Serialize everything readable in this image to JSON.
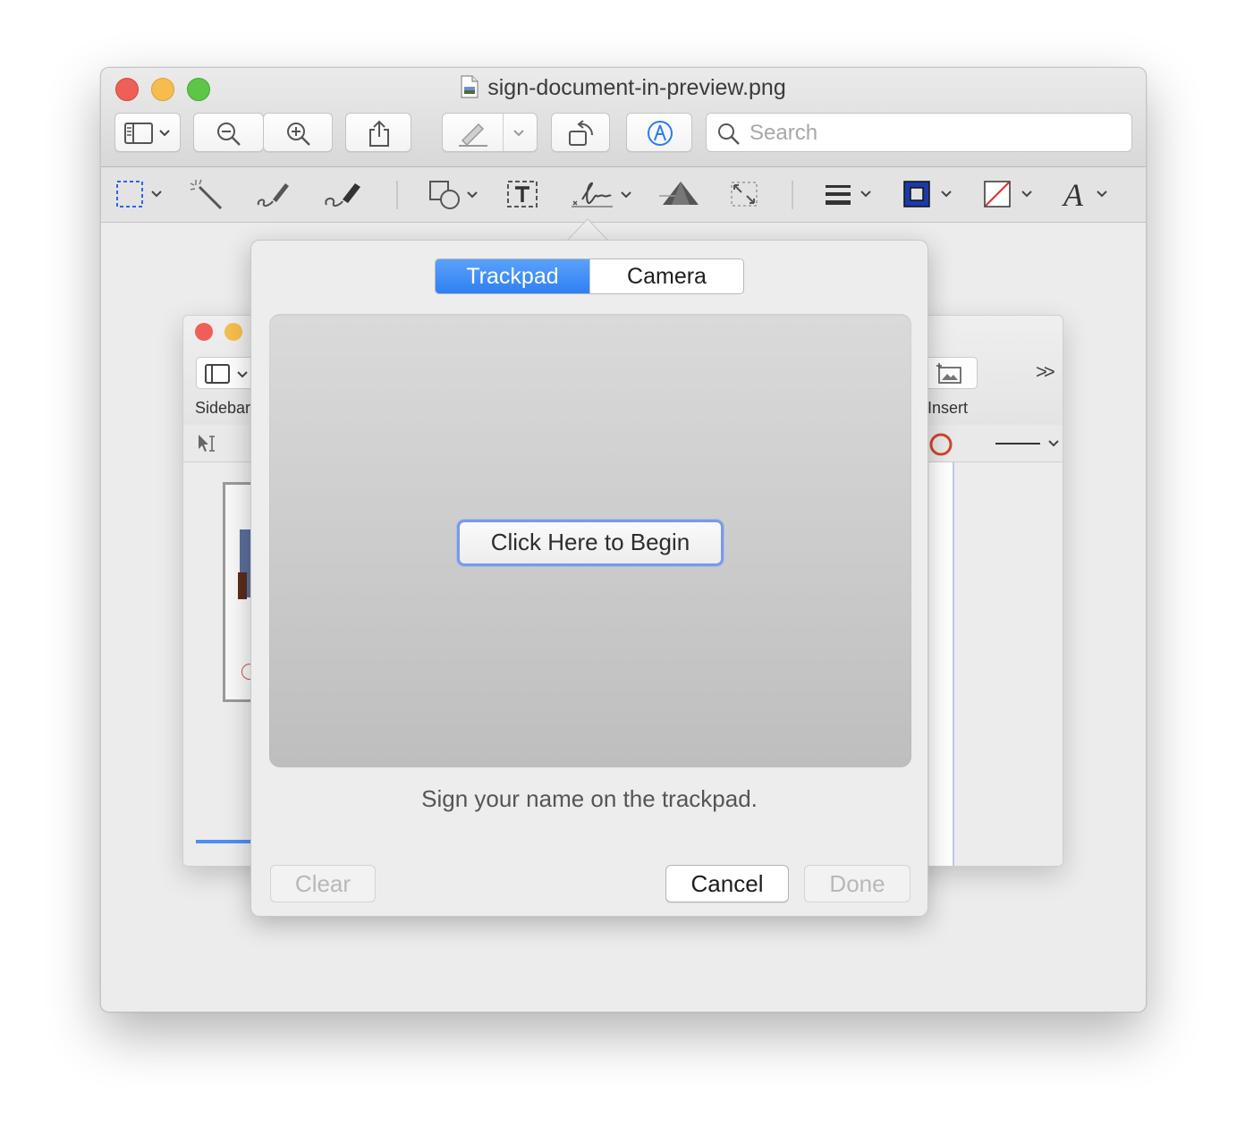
{
  "window": {
    "title": "sign-document-in-preview.png"
  },
  "toolbar": {
    "search_placeholder": "Search"
  },
  "background_window": {
    "sidebar_label": "Sidebar",
    "insert_label": "Insert",
    "overflow_glyph": ">>"
  },
  "signature_popover": {
    "tabs": [
      {
        "label": "Trackpad",
        "selected": true
      },
      {
        "label": "Camera",
        "selected": false
      }
    ],
    "begin_button": "Click Here to Begin",
    "instruction": "Sign your name on the trackpad.",
    "buttons": {
      "clear": "Clear",
      "cancel": "Cancel",
      "done": "Done"
    }
  },
  "colors": {
    "accent": "#2e7ff3",
    "close": "#ee5f57",
    "minimize": "#f6bd4e",
    "zoom": "#5dc648",
    "border_color_swatch": "#1b3aa8",
    "fill_color_slash": "#e0302c",
    "shape_circle_red": "#d0452e"
  }
}
